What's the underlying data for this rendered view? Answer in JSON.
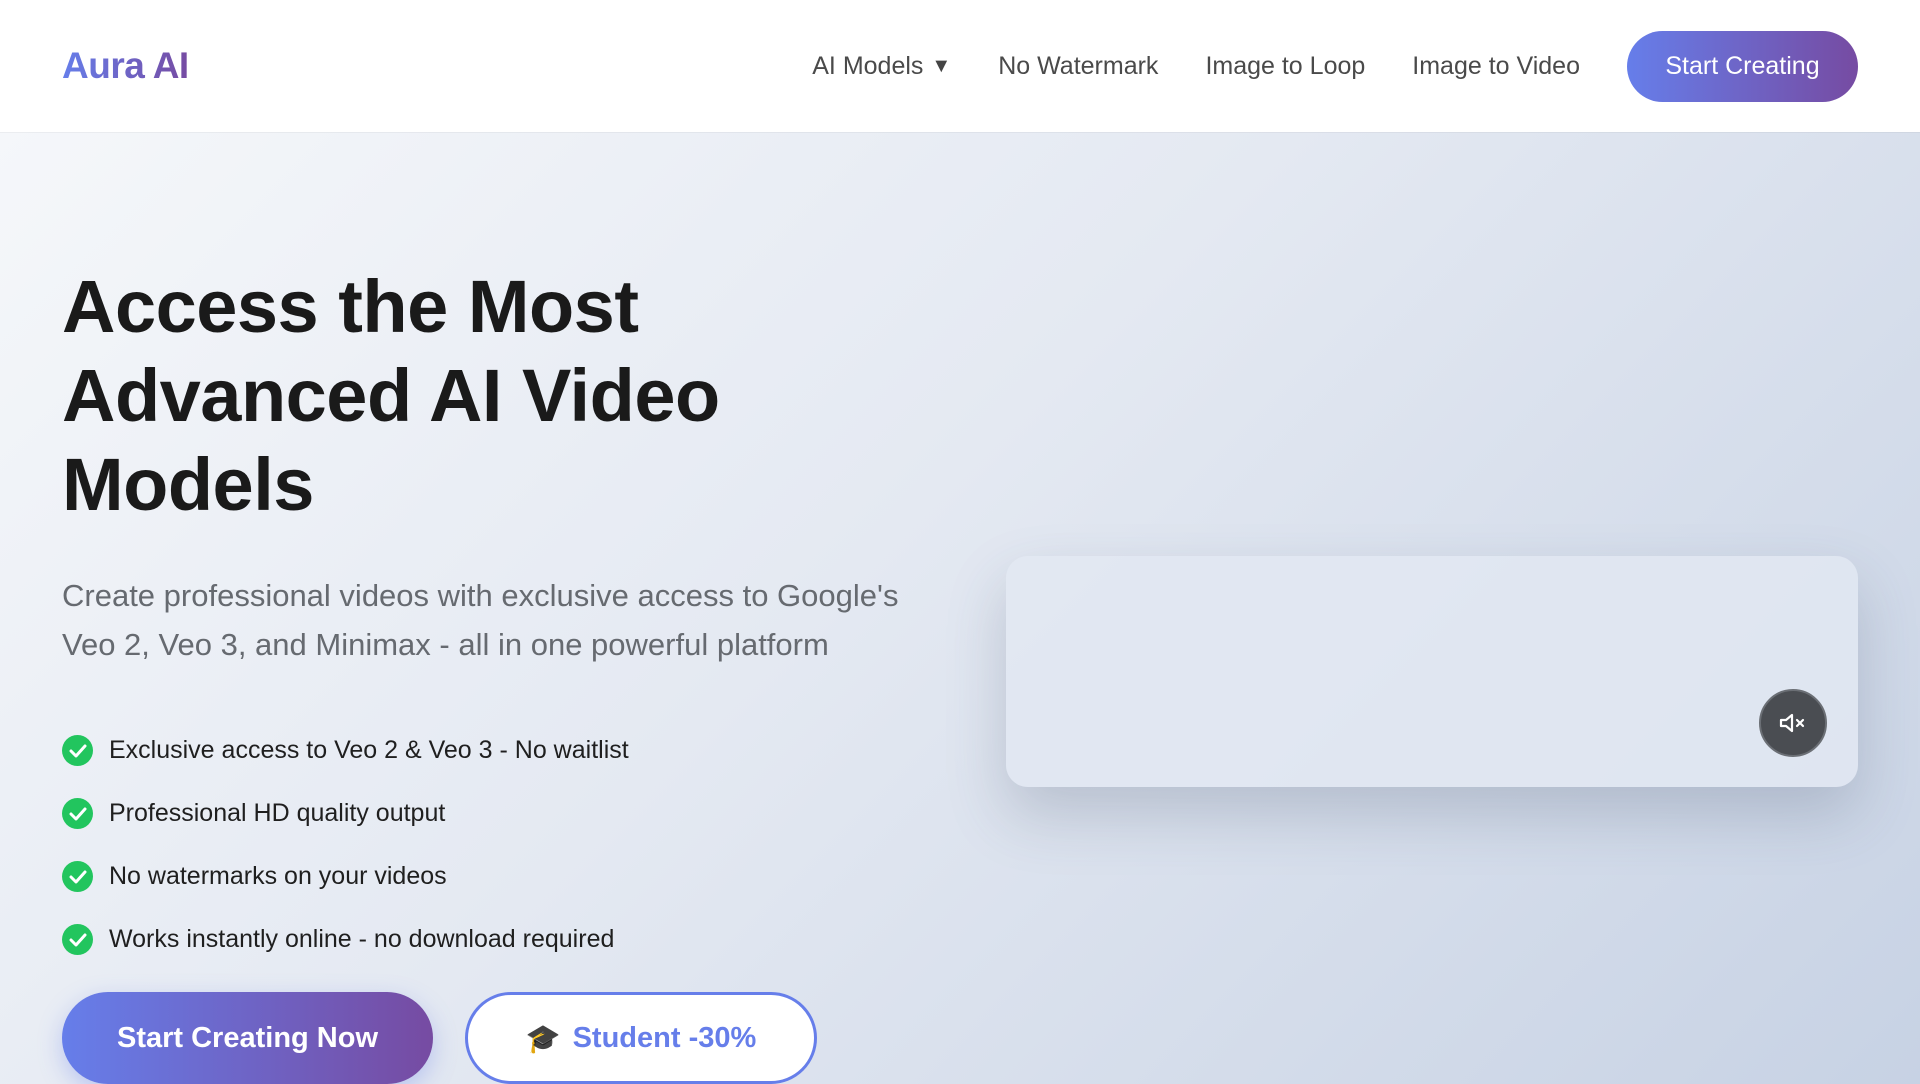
{
  "nav": {
    "logo": "Aura AI",
    "links": [
      {
        "label": "AI Models",
        "has_dropdown": true
      },
      {
        "label": "No Watermark"
      },
      {
        "label": "Image to Loop"
      },
      {
        "label": "Image to Video"
      }
    ],
    "cta": "Start Creating",
    "caret": "▼"
  },
  "hero": {
    "title": "Access the Most Advanced AI Video Models",
    "subtitle": "Create professional videos with exclusive access to Google's Veo 2, Veo 3, and Minimax - all in one powerful platform",
    "features": [
      "Exclusive access to Veo 2 & Veo 3 - No waitlist",
      "Professional HD quality output",
      "No watermarks on your videos",
      "Works instantly online - no download required"
    ],
    "primary_button": "Start Creating Now",
    "secondary_button": "Student -30%",
    "secondary_icon": "🎓"
  },
  "video": {
    "mute_icon": "speaker-muted-icon"
  },
  "colors": {
    "accent_start": "#667eea",
    "accent_end": "#764ba2",
    "check": "#22c55e"
  }
}
